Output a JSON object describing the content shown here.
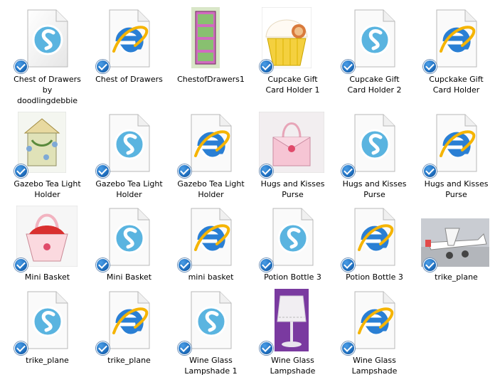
{
  "files": [
    {
      "label": "Chest of Drawers\nby\ndoodlingdebbie",
      "icon": "silhouette-document-icon"
    },
    {
      "label": "Chest of Drawers",
      "icon": "internet-explorer-icon"
    },
    {
      "label": "ChestofDrawers1",
      "icon": "photo-thumbnail"
    },
    {
      "label": "Cupcake Gift\nCard Holder 1",
      "icon": "photo-thumbnail"
    },
    {
      "label": "Cupcake Gift\nCard Holder 2",
      "icon": "silhouette-document-icon"
    },
    {
      "label": "Cupckake Gift\nCard Holder",
      "icon": "internet-explorer-icon"
    },
    {
      "label": "Gazebo Tea Light\nHolder",
      "icon": "photo-thumbnail"
    },
    {
      "label": "Gazebo Tea Light\nHolder",
      "icon": "silhouette-document-icon"
    },
    {
      "label": "Gazebo Tea Light\nHolder",
      "icon": "internet-explorer-icon"
    },
    {
      "label": "Hugs and Kisses\nPurse",
      "icon": "photo-thumbnail"
    },
    {
      "label": "Hugs and Kisses\nPurse",
      "icon": "silhouette-document-icon"
    },
    {
      "label": "Hugs and Kisses\nPurse",
      "icon": "internet-explorer-icon"
    },
    {
      "label": "Mini Basket",
      "icon": "photo-thumbnail"
    },
    {
      "label": "Mini Basket",
      "icon": "silhouette-document-icon"
    },
    {
      "label": "mini basket",
      "icon": "internet-explorer-icon"
    },
    {
      "label": "Potion Bottle 3",
      "icon": "silhouette-document-icon"
    },
    {
      "label": "Potion Bottle 3",
      "icon": "internet-explorer-icon"
    },
    {
      "label": "trike_plane",
      "icon": "photo-thumbnail"
    },
    {
      "label": "trike_plane",
      "icon": "silhouette-document-icon"
    },
    {
      "label": "trike_plane",
      "icon": "internet-explorer-icon"
    },
    {
      "label": "Wine Glass\nLampshade 1",
      "icon": "silhouette-document-icon"
    },
    {
      "label": "Wine Glass\nLampshade",
      "icon": "photo-thumbnail"
    },
    {
      "label": "Wine Glass\nLampshade",
      "icon": "internet-explorer-icon"
    }
  ],
  "colors": {
    "silhouette_blue": "#5ab4e0",
    "ie_blue": "#2a7fd4",
    "ie_gold": "#f5b400",
    "check_blue": "#1f6fbf"
  }
}
